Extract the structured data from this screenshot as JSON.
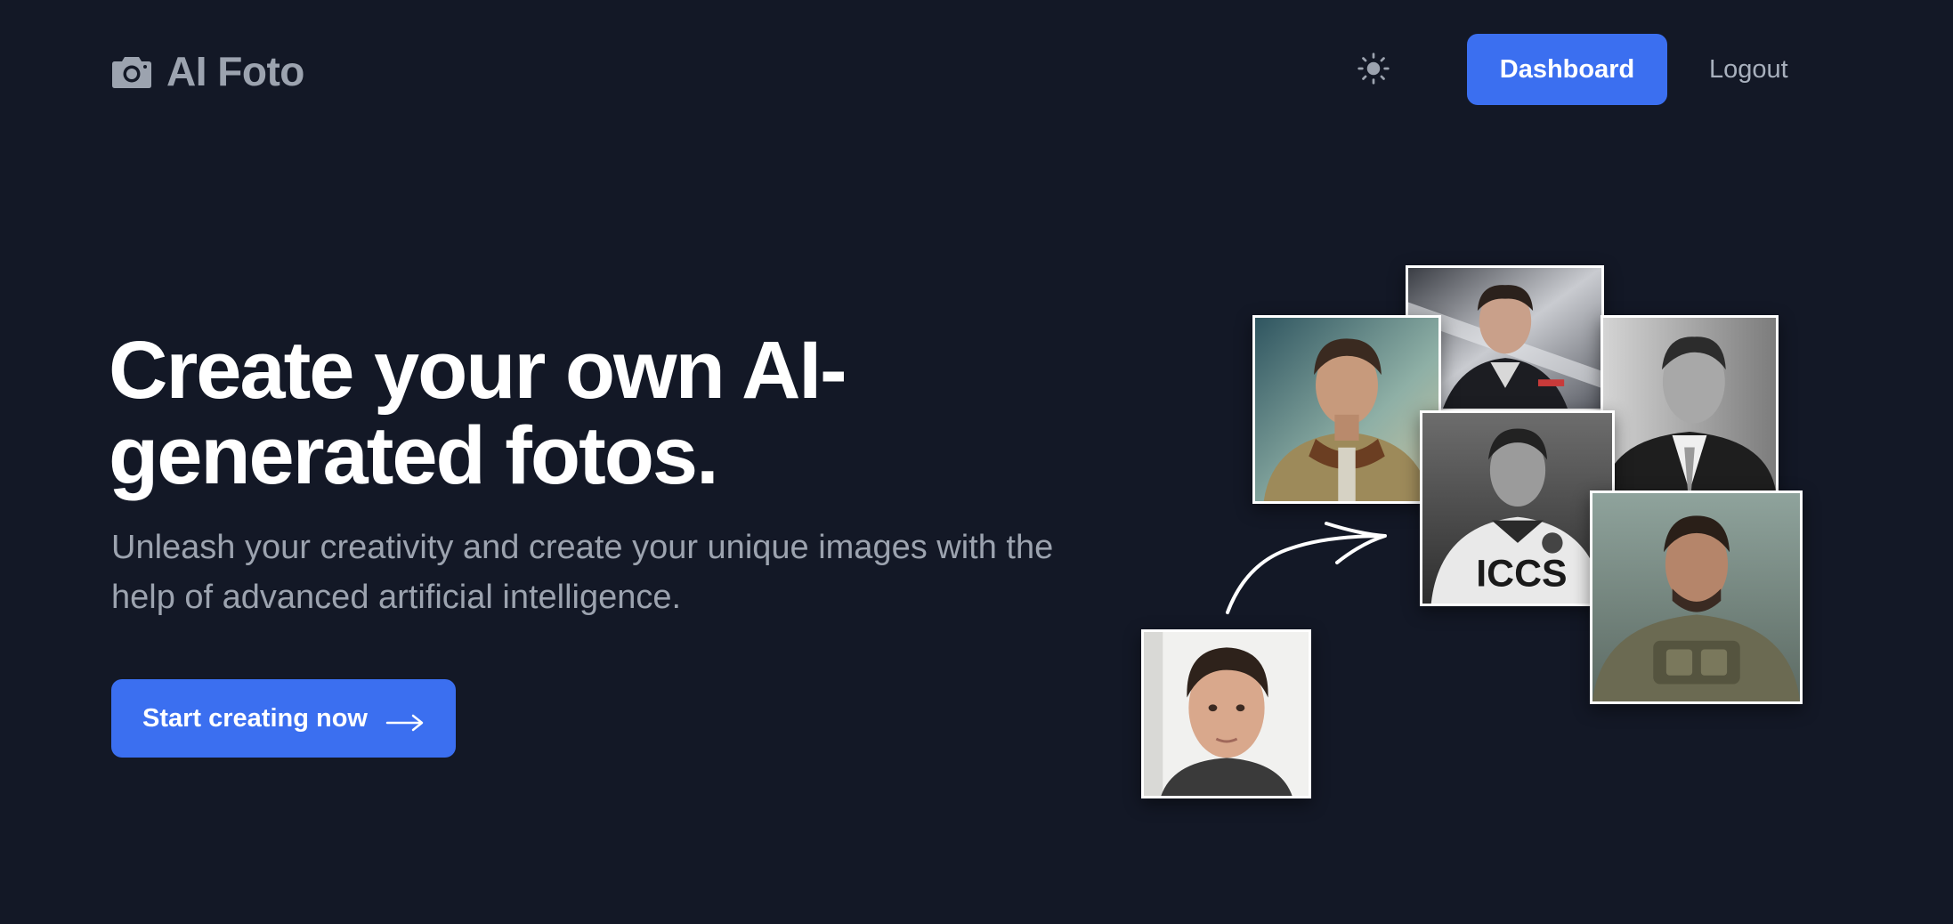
{
  "header": {
    "brand": {
      "name": "AI Foto",
      "icon": "camera-icon"
    },
    "theme_toggle_icon": "sun-icon",
    "dashboard_label": "Dashboard",
    "logout_label": "Logout"
  },
  "hero": {
    "title": "Create your own AI-generated fotos.",
    "subtitle": "Unleash your creativity and create your unique images with the help of advanced artificial intelligence.",
    "cta_label": "Start creating now",
    "cta_icon": "arrow-right-icon"
  },
  "collage": {
    "arrow_icon": "curved-arrow-icon",
    "photos": [
      {
        "name": "photo-source-selfie",
        "description": "original selfie"
      },
      {
        "name": "photo-bomber-jacket"
      },
      {
        "name": "photo-race-driver"
      },
      {
        "name": "photo-business-suit"
      },
      {
        "name": "photo-soccer-jersey"
      },
      {
        "name": "photo-soldier"
      }
    ]
  },
  "colors": {
    "background": "#131826",
    "accent": "#3b6ff0",
    "muted_text": "#9ca3af",
    "heading_text": "#ffffff"
  }
}
